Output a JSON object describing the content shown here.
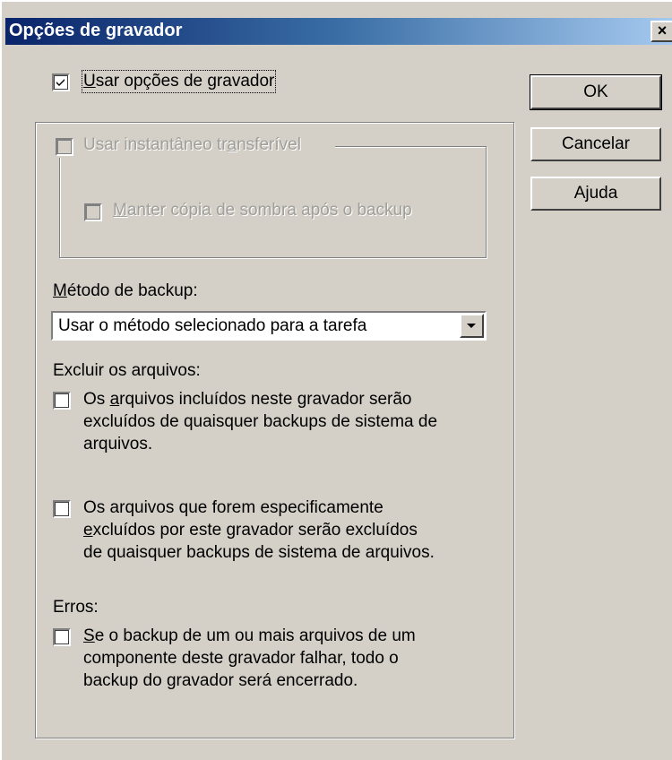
{
  "window": {
    "title": "Opções de gravador",
    "close_glyph": "×"
  },
  "use_writer_options": {
    "checked": true,
    "underline_char": "U",
    "label_rest": "sar opções de gravador"
  },
  "snapshot_group": {
    "pre": "Usar instantâneo tr",
    "underline_char": "a",
    "post": "nsferível",
    "disabled": true,
    "shadow_copy": {
      "underline_char": "M",
      "label_rest": "anter cópia de sombra após o backup",
      "disabled": true
    }
  },
  "backup_method": {
    "underline_char": "M",
    "label_rest": "étodo de backup:",
    "selected": "Usar o método selecionado para a tarefa"
  },
  "exclude_files": {
    "header": "Excluir os arquivos:",
    "option1": {
      "line1_pre": "Os ",
      "line1_u": "a",
      "line1_post": "rquivos incluídos neste gravador serão",
      "line2": "excluídos de quaisquer backups de sistema de",
      "line3": "arquivos."
    },
    "option2": {
      "line1": "Os arquivos que forem especificamente",
      "line2_u": "e",
      "line2_post": "xcluídos por este gravador serão excluídos",
      "line3": "de quaisquer backups de sistema de arquivos."
    }
  },
  "errors": {
    "header": "Erros:",
    "option": {
      "line1_u": "S",
      "line1_post": "e o backup de um ou mais arquivos de um",
      "line2": "componente deste gravador falhar, todo o",
      "line3": "backup do gravador será encerrado."
    }
  },
  "buttons": {
    "ok": "OK",
    "cancel": "Cancelar",
    "help": "Ajuda"
  },
  "colors": {
    "face": "#d4d0c8",
    "title_start": "#0a246a",
    "title_end": "#a6caf0",
    "disabled_text": "#a09e99"
  }
}
